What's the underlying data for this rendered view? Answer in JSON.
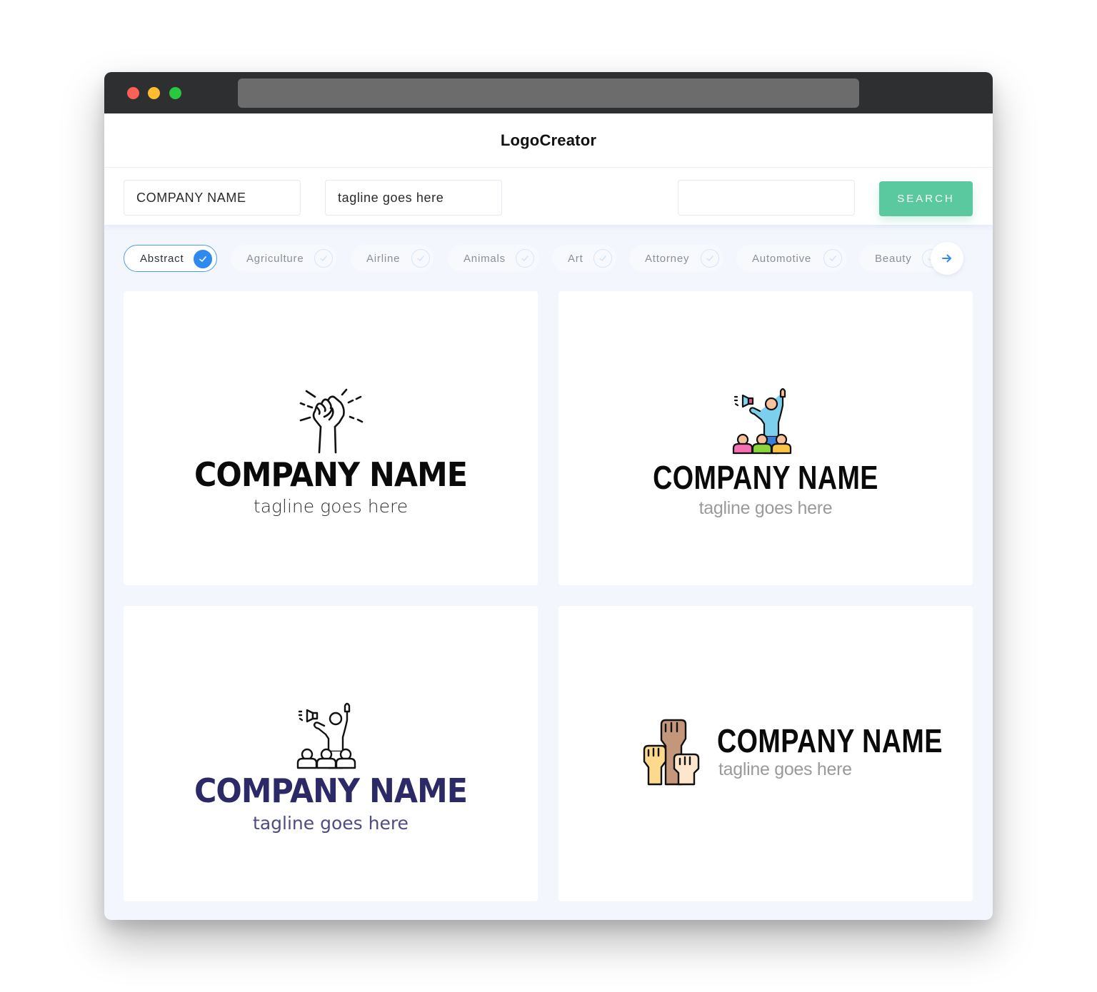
{
  "window": {
    "traffic_lights": [
      "close",
      "minimize",
      "maximize"
    ],
    "colors": {
      "close": "#fe5f57",
      "minimize": "#febc2e",
      "maximize": "#28c840"
    }
  },
  "header": {
    "title": "LogoCreator"
  },
  "search": {
    "company_name_value": "COMPANY NAME",
    "tagline_value": "tagline goes here",
    "keyword_value": "",
    "button_label": "SEARCH",
    "button_color": "#5bc99f"
  },
  "categories": {
    "items": [
      {
        "label": "Abstract",
        "selected": true
      },
      {
        "label": "Agriculture",
        "selected": false
      },
      {
        "label": "Airline",
        "selected": false
      },
      {
        "label": "Animals",
        "selected": false
      },
      {
        "label": "Art",
        "selected": false
      },
      {
        "label": "Attorney",
        "selected": false
      },
      {
        "label": "Automotive",
        "selected": false
      },
      {
        "label": "Beauty",
        "selected": false
      }
    ],
    "next_icon": "arrow-right-icon",
    "accent_color": "#2f8af0"
  },
  "logos": [
    {
      "icon": "raised-fist-outline-icon",
      "company_name": "COMPANY NAME",
      "tagline": "tagline goes here",
      "name_color": "#0a0a0a",
      "tagline_color": "#333333"
    },
    {
      "icon": "speaker-crowd-color-icon",
      "company_name": "COMPANY NAME",
      "tagline": "tagline goes here",
      "name_color": "#0a0a0a",
      "tagline_color": "#9a9a9a"
    },
    {
      "icon": "speaker-crowd-outline-icon",
      "company_name": "COMPANY NAME",
      "tagline": "tagline goes here",
      "name_color": "#2b2966",
      "tagline_color": "#4e4c82"
    },
    {
      "icon": "three-raised-fists-color-icon",
      "company_name": "COMPANY NAME",
      "tagline": "tagline goes here",
      "name_color": "#0a0a0a",
      "tagline_color": "#9a9a9a"
    }
  ]
}
